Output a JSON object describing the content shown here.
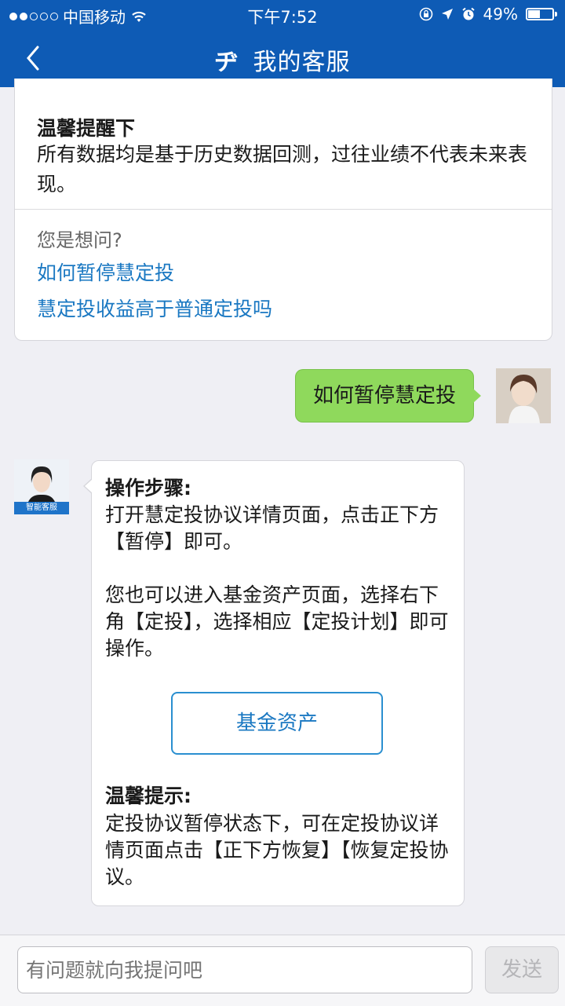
{
  "status_bar": {
    "carrier": "中国移动",
    "time": "下午7:52",
    "battery": "49%",
    "battery_level": 0.49,
    "signal_bars_filled": 2,
    "signal_bars_total": 5
  },
  "nav": {
    "glyph": "ヂ",
    "title": "我的客服"
  },
  "tip_card": {
    "title": "温馨提醒下",
    "body": "所有数据均是基于历史数据回测，过往业绩不代表未来表现。",
    "ask_label": "您是想问?",
    "links": [
      "如何暂停慧定投",
      "慧定投收益高于普通定投吗"
    ]
  },
  "user_message": "如何暂停慧定投",
  "bot": {
    "badge": "智能客服",
    "steps_title": "操作步骤:",
    "steps_body": "打开慧定投协议详情页面，点击正下方【暂停】即可。",
    "alt_body": "您也可以进入基金资产页面，选择右下角【定投】，选择相应【定投计划】即可操作。",
    "button_label": "基金资产",
    "tip_title": "温馨提示:",
    "tip_body": "定投协议暂停状态下，可在定投协议详情页面点击【正下方恢复】【恢复定投协议。"
  },
  "input": {
    "placeholder": "有问题就向我提问吧",
    "send_label": "发送"
  },
  "colors": {
    "nav_bg": "#0e5bb5",
    "link": "#1a78c2",
    "user_bubble": "#8fd95c",
    "bg": "#efeff4"
  },
  "icons": [
    "back-chevron-icon",
    "wifi-icon",
    "lock-rotation-icon",
    "location-arrow-icon",
    "alarm-icon",
    "battery-icon"
  ]
}
